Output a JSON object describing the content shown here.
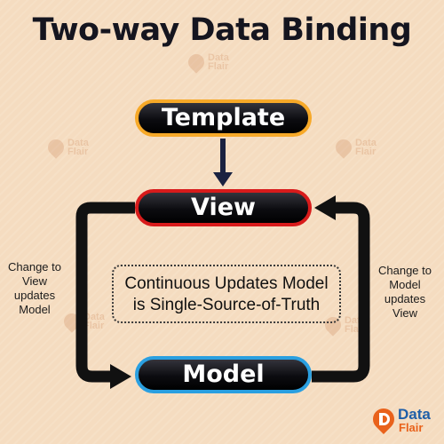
{
  "title": "Two-way Data Binding",
  "nodes": {
    "template": "Template",
    "view": "View",
    "model": "Model"
  },
  "labels": {
    "left": [
      "Change to",
      "View",
      "updates",
      "Model"
    ],
    "right": [
      "Change to",
      "Model",
      "updates",
      "View"
    ],
    "center": [
      "Continuous Updates Model",
      "is Single-Source-of-Truth"
    ]
  },
  "brand": {
    "data": "Data",
    "flair": "Flair"
  },
  "colors": {
    "template_border": "#f7a928",
    "view_border": "#d81b1b",
    "model_border": "#2a9fe0",
    "arrow": "#111111",
    "template_arrow": "#1a2240",
    "background": "#f5dcc0"
  },
  "icons": {
    "logo": "dataflair-logo",
    "watermark": "dataflair-watermark"
  }
}
